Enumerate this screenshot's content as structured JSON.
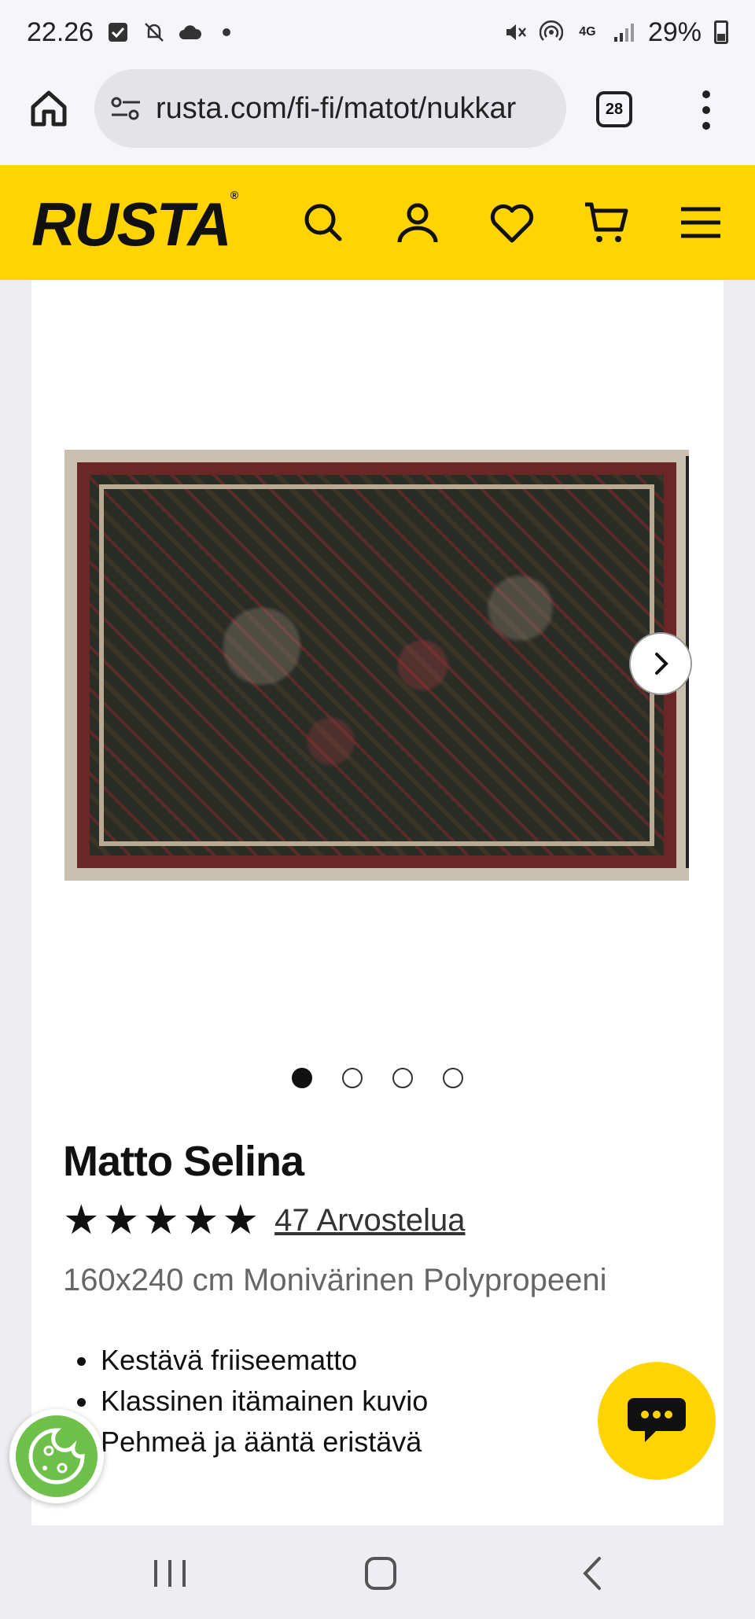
{
  "status_bar": {
    "time": "22.26",
    "battery_percent": "29%",
    "network": "4G"
  },
  "browser": {
    "url": "rusta.com/fi-fi/matot/nukkar",
    "tab_count": "28"
  },
  "site_header": {
    "logo_text": "RUSTA",
    "accent_color": "#ffd400"
  },
  "product": {
    "title": "Matto Selina",
    "rating_stars": 5,
    "reviews_link": "47 Arvostelua",
    "subtitle": "160x240 cm Monivärinen Polypropeeni",
    "features": [
      "Kestävä friiseematto",
      "Klassinen itämainen kuvio",
      "Pehmeä ja ääntä eristävä"
    ],
    "carousel": {
      "image_count": 4,
      "active_index": 0
    }
  },
  "icons": {
    "header": [
      "search-icon",
      "account-icon",
      "heart-icon",
      "cart-icon",
      "hamburger-menu-icon"
    ],
    "floating": [
      "chat-icon",
      "cookie-icon"
    ]
  }
}
